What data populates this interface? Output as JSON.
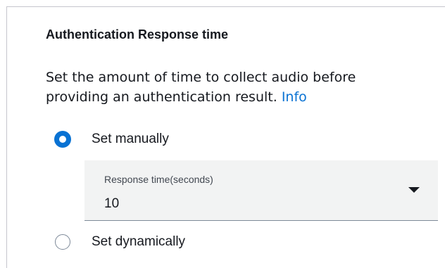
{
  "section": {
    "title": "Authentication Response time",
    "description": "Set the amount of time to collect audio before providing an authentication result.",
    "info_link": "Info"
  },
  "options": {
    "manual": {
      "label": "Set manually",
      "selected": true
    },
    "dynamic": {
      "label": "Set dynamically",
      "selected": false
    }
  },
  "response_time_select": {
    "label": "Response time(seconds)",
    "value": "10",
    "icon": "caret-down-icon"
  },
  "colors": {
    "accent": "#0972d3",
    "text": "#16191f",
    "field_background": "#f2f3f3",
    "border": "#c6c6cd"
  }
}
